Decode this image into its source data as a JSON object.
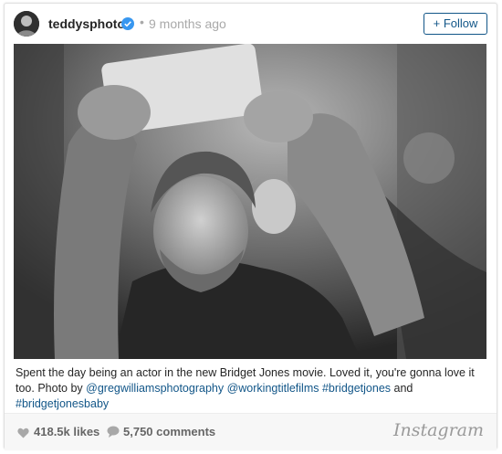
{
  "header": {
    "username": "teddysphotos",
    "separator": "•",
    "time_ago": "9 months ago",
    "follow_label": "+ Follow",
    "verified_icon": "verified-badge-icon",
    "verified_color": "#3897f0"
  },
  "photo": {
    "description_visible": false
  },
  "caption": {
    "text_start": "Spent the day being an actor in the new Bridget Jones movie. Loved it, you're gonna love it too. Photo by ",
    "mention_1": "@gregwilliamsphotography",
    "mention_2": "@workingtitlefilms",
    "hashtag_1": "#bridgetjones",
    "and_word": "and",
    "hashtag_2": "#bridgetjonesbaby",
    "link_color": "#125688"
  },
  "footer": {
    "likes": "418.5k likes",
    "comments": "5,750 comments",
    "likes_icon": "heart-icon",
    "comments_icon": "speech-bubble-icon",
    "logo": "Instagram"
  }
}
